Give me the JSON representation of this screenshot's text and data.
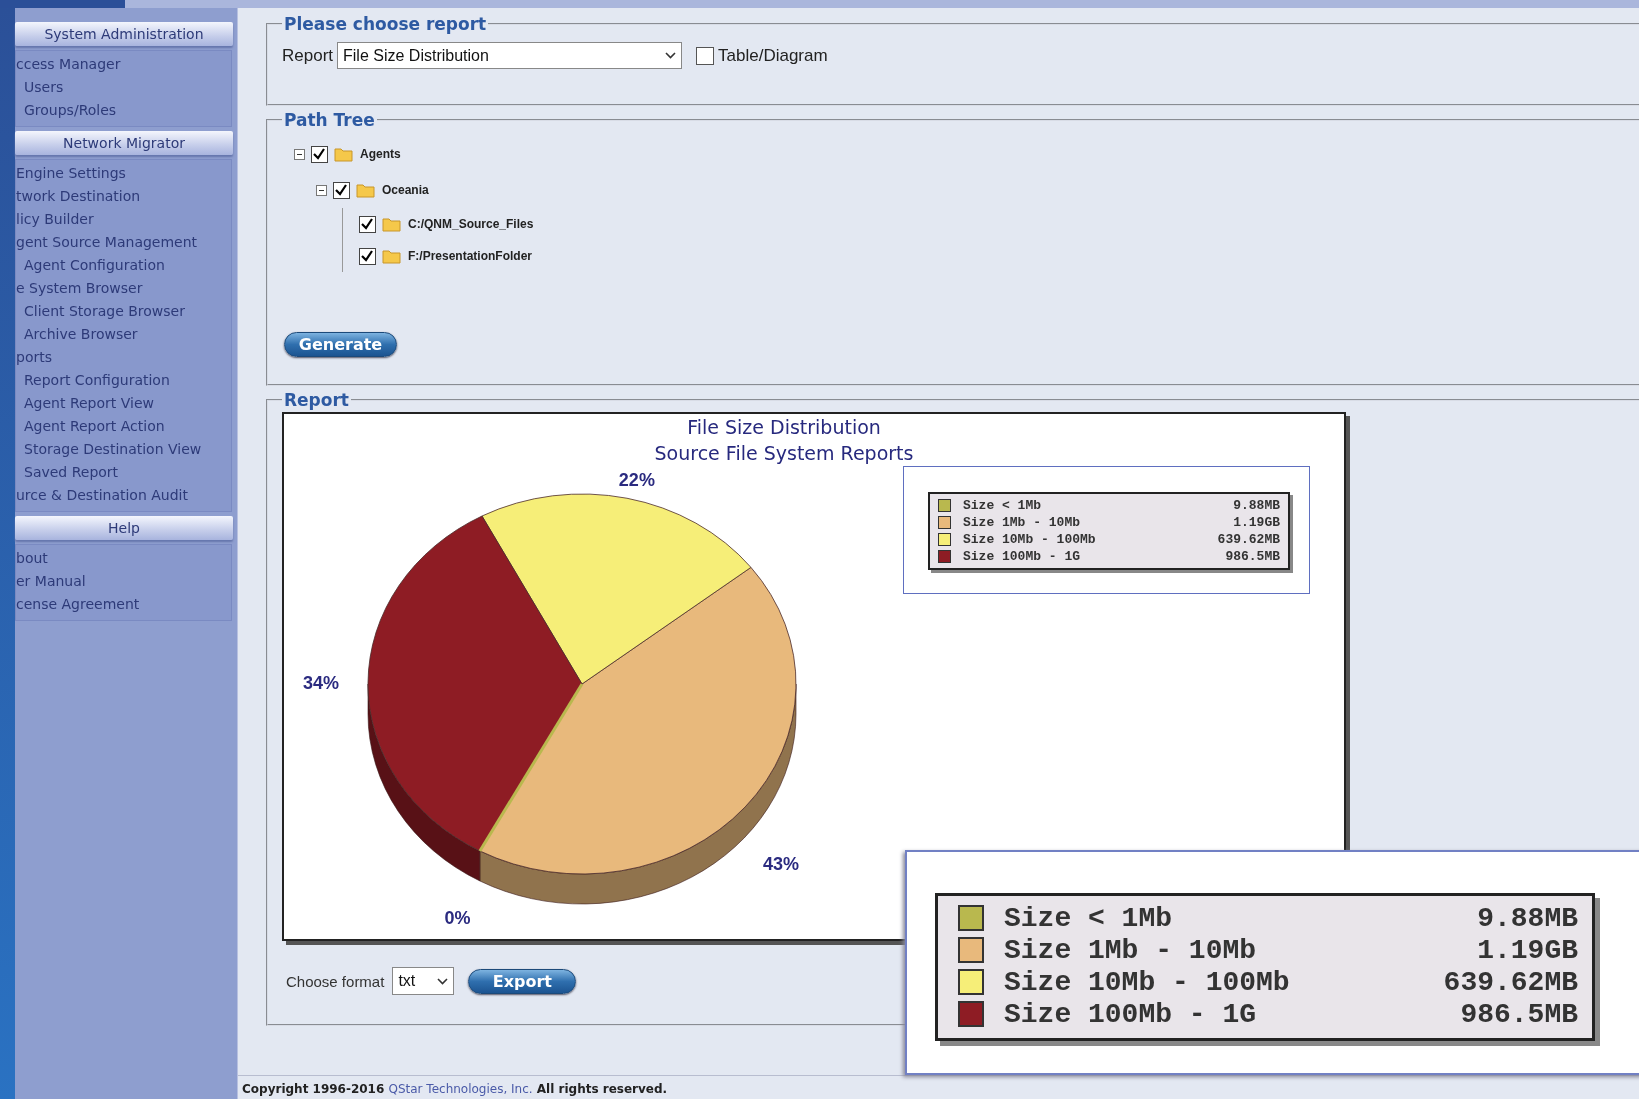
{
  "sidebar": {
    "sections": [
      {
        "title": "System Administration",
        "items": [
          {
            "label": "ccess Manager",
            "children": [
              {
                "label": "Users"
              },
              {
                "label": "Groups/Roles"
              }
            ]
          }
        ]
      },
      {
        "title": "Network Migrator",
        "items": [
          {
            "label": "Engine Settings"
          },
          {
            "label": "twork Destination"
          },
          {
            "label": "licy Builder"
          },
          {
            "label": "gent Source Management",
            "children": [
              {
                "label": "Agent Configuration"
              }
            ]
          },
          {
            "label": "e System Browser",
            "children": [
              {
                "label": "Client Storage Browser"
              },
              {
                "label": "Archive Browser"
              }
            ]
          },
          {
            "label": "ports",
            "children": [
              {
                "label": "Report Configuration"
              },
              {
                "label": "Agent Report View"
              },
              {
                "label": "Agent Report Action"
              },
              {
                "label": "Storage Destination View"
              },
              {
                "label": "Saved Report"
              }
            ]
          },
          {
            "label": "urce & Destination Audit"
          }
        ]
      },
      {
        "title": "Help",
        "items": [
          {
            "label": "bout"
          },
          {
            "label": "er Manual"
          },
          {
            "label": "cense Agreement"
          }
        ]
      }
    ]
  },
  "choose_report": {
    "title": "Please choose report",
    "label": "Report",
    "value": "File Size Distribution",
    "table_diagram": {
      "label": "Table/Diagram",
      "checked": false
    }
  },
  "path_tree": {
    "title": "Path Tree",
    "nodes": [
      {
        "label": "Agents",
        "checked": true,
        "expanded": true,
        "children": [
          {
            "label": "Oceania",
            "checked": true,
            "expanded": true,
            "children": [
              {
                "label": "C:/QNM_Source_Files",
                "checked": true
              },
              {
                "label": "F:/PresentationFolder",
                "checked": true
              }
            ]
          }
        ]
      }
    ],
    "button": "Generate"
  },
  "report": {
    "title": "Report",
    "subtitle": "Source File System Reports",
    "chart_data": {
      "type": "pie",
      "title": "File Size Distribution",
      "legend": "upper right",
      "categories": [
        "Size < 1Mb",
        "Size 1Mb - 10Mb",
        "Size 10Mb - 100Mb",
        "Size 100Mb - 1G"
      ],
      "values": [
        0,
        43,
        22,
        34
      ],
      "value_labels": [
        "0%",
        "43%",
        "22%",
        "34%"
      ]
    },
    "legend": [
      {
        "value": "9.88MB",
        "color": "#b9b84e"
      },
      {
        "value": "1.19GB",
        "color": "#e8b97c"
      },
      {
        "value": "639.62MB",
        "color": "#f6ee78"
      },
      {
        "value": "986.5MB",
        "color": "#8e1c24"
      }
    ],
    "format_label": "Choose format",
    "format": "txt",
    "export_button": "Export"
  },
  "magnified_legend": [
    {
      "label": "Size < 1Mb",
      "value": "9.88MB",
      "color": "#b9b84e"
    },
    {
      "label": "Size 1Mb - 10Mb",
      "value": "1.19GB",
      "color": "#e8b97c"
    },
    {
      "label": "Size 10Mb - 100Mb",
      "value": "639.62MB",
      "color": "#f6ee78"
    },
    {
      "label": "Size 100Mb - 1G",
      "value": "986.5MB",
      "color": "#8e1c24"
    }
  ],
  "footer": {
    "before": "Copyright 1996-2016 ",
    "link": "QStar Technologies, Inc.",
    "after": " All rights reserved."
  }
}
